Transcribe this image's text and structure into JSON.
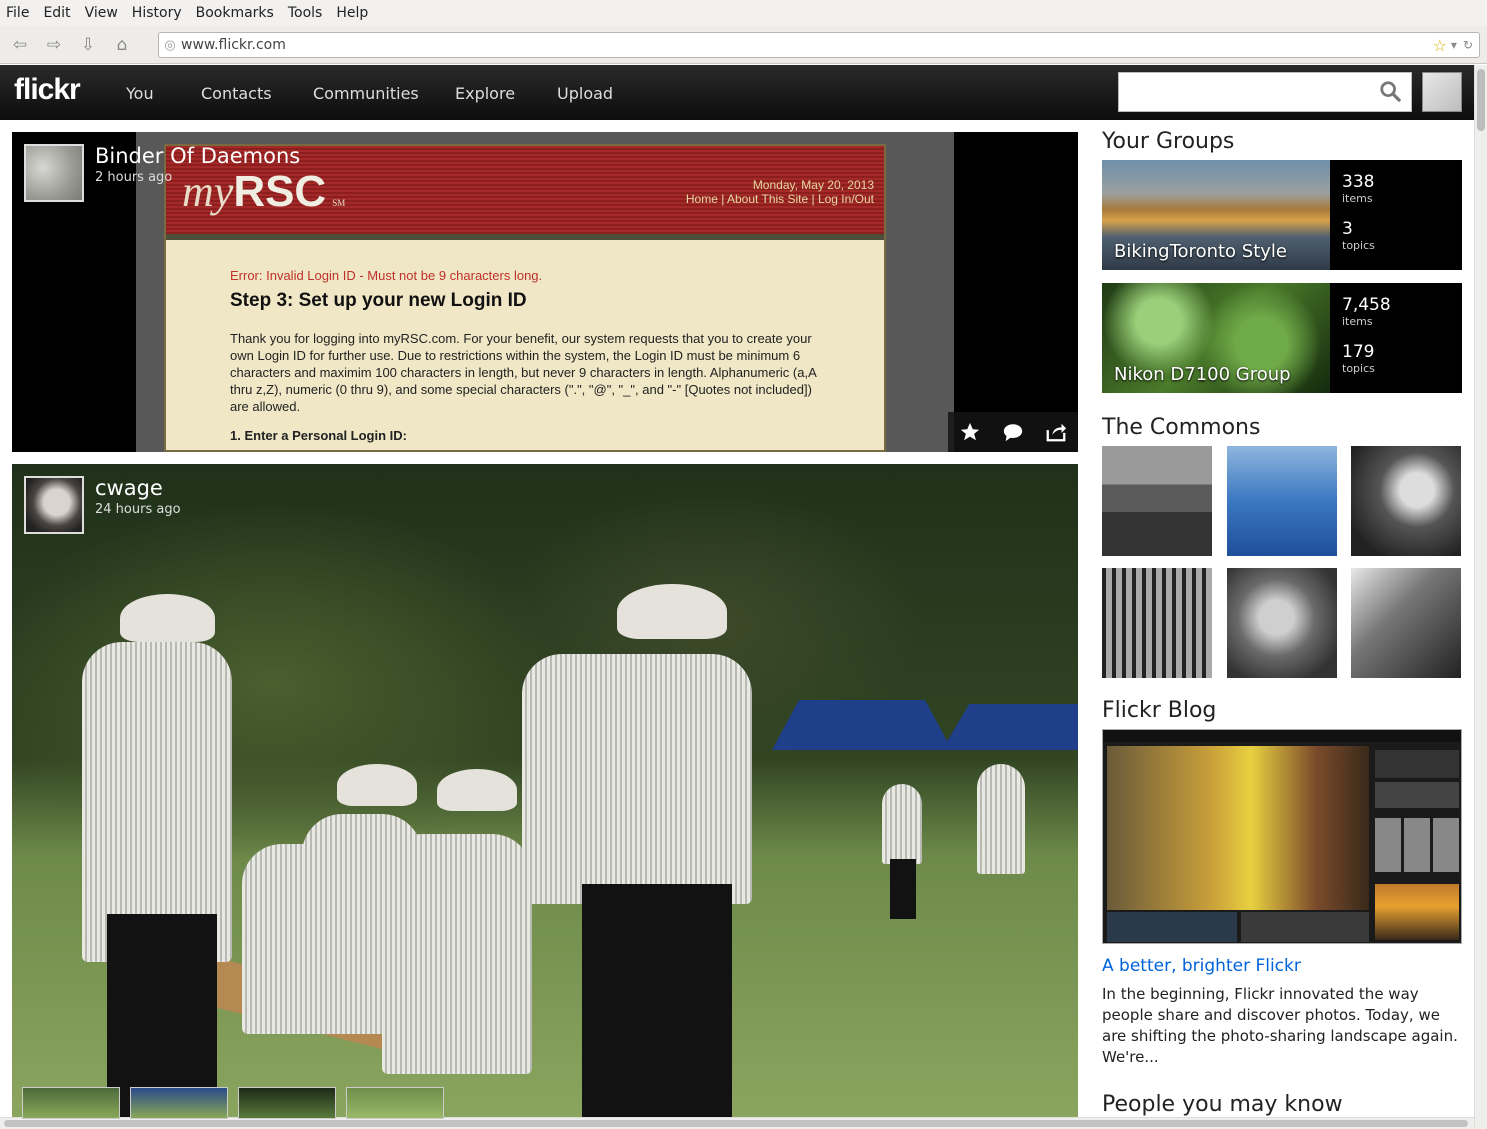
{
  "browser": {
    "menu": [
      "File",
      "Edit",
      "View",
      "History",
      "Bookmarks",
      "Tools",
      "Help"
    ],
    "url": "www.flickr.com"
  },
  "header": {
    "logo": "flickr",
    "nav": [
      "You",
      "Contacts",
      "Communities",
      "Explore",
      "Upload"
    ],
    "search_placeholder": ""
  },
  "feed": [
    {
      "owner": "Binder Of Daemons",
      "time": "2 hours ago",
      "screenshot": {
        "logo_script": "my",
        "logo_bold": "RSC",
        "sm": "SM",
        "date": "Monday, May 20, 2013",
        "links": "Home | About This Site | Log In/Out",
        "error": "Error: Invalid Login ID - Must not be 9 characters long.",
        "heading": "Step 3: Set up your new Login ID",
        "paragraph": "Thank you for logging into myRSC.com. For your benefit, our system requests that you to create your own Login ID for further use. Due to restrictions within the system, the Login ID must be minimum 6 characters and maximim 100 characters in length, but never 9 characters in length. Alphanumeric (a,A thru z,Z), numeric (0 thru 9), and some special characters (\".\", \"@\", \"_\", and \"-\" [Quotes not included]) are allowed.",
        "field_label": "1.  Enter a Personal Login ID:"
      }
    },
    {
      "owner": "cwage",
      "time": "24 hours ago"
    }
  ],
  "sidebar": {
    "groups_title": "Your Groups",
    "groups": [
      {
        "name": "BikingToronto Style",
        "items": "338",
        "items_label": "items",
        "topics": "3",
        "topics_label": "topics"
      },
      {
        "name": "Nikon D7100 Group",
        "items": "7,458",
        "items_label": "items",
        "topics": "179",
        "topics_label": "topics"
      }
    ],
    "commons_title": "The Commons",
    "blog_title": "Flickr Blog",
    "blog_post_title": "A better, brighter Flickr",
    "blog_post_text": "In the beginning, Flickr innovated the way people share and discover photos. Today, we are shifting the photo-sharing landscape again. We're...",
    "people_title": "People you may know"
  }
}
